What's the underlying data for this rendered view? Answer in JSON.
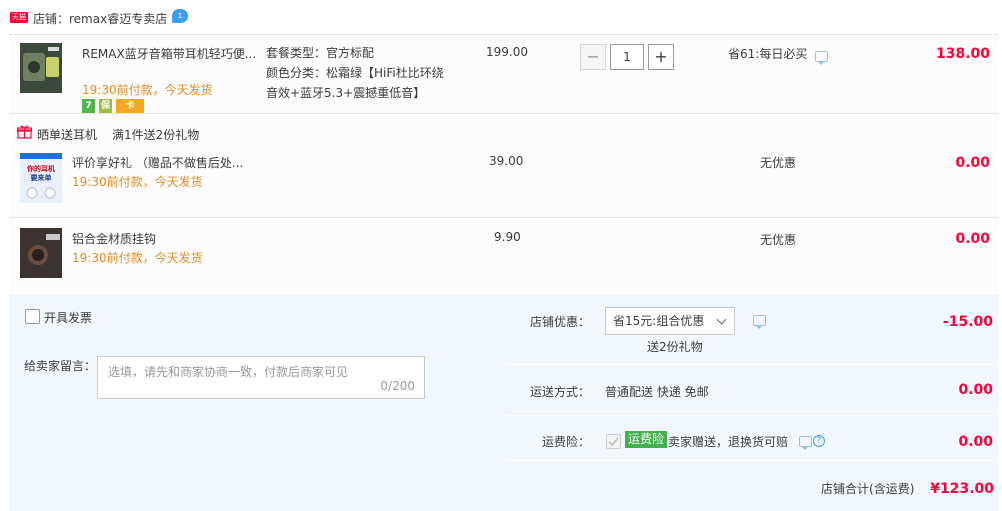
{
  "shop": {
    "badge": "天猫",
    "name": "店铺：remax睿迈专卖店",
    "chat_badge": "1"
  },
  "items": [
    {
      "title": "REMAX蓝牙音箱带耳机轻巧便...",
      "ship_note": "19:30前付款，今天发货",
      "sku_lines": [
        "套餐类型：官方标配",
        "颜色分类：松霜绿【HiFi杜比环绕",
        "音效+蓝牙5.3+震撼重低音】"
      ],
      "price": "199.00",
      "quantity": "1",
      "promo": "省61:每日必买",
      "total": "138.00",
      "feature_icons": [
        "7",
        "保",
        "卡"
      ]
    },
    {
      "title": "评价享好礼 （赠品不做售后处...",
      "ship_note": "19:30前付款，今天发货",
      "price": "39.00",
      "promo": "无优惠",
      "total": "0.00",
      "thumb_text": "你的耳机要来单"
    },
    {
      "title": "铝合金材质挂钩",
      "ship_note": "19:30前付款，今天发货",
      "price": "9.90",
      "promo": "无优惠",
      "total": "0.00"
    }
  ],
  "gift_promo": {
    "label": "晒单送耳机",
    "desc": "满1件送2份礼物"
  },
  "invoice": {
    "label": "开具发票"
  },
  "message": {
    "label": "给卖家留言：",
    "placeholder": "选填，请先和商家协商一致，付款后商家可见",
    "counter": "0/200"
  },
  "store_discount": {
    "label": "店铺优惠：",
    "selected": "省15元:组合优惠",
    "gift_note": "送2份礼物",
    "amount": "-15.00"
  },
  "delivery": {
    "label": "运送方式：",
    "value": "普通配送 快递 免邮",
    "amount": "0.00"
  },
  "insurance": {
    "label": "运费险：",
    "tag": "运费险",
    "desc": "卖家赠送，退换货可赔",
    "amount": "0.00"
  },
  "grand_total": {
    "label": "店铺合计(含运费)",
    "amount": "¥123.00"
  },
  "colors": {
    "accent_red": "#ff0036",
    "ship_orange": "#e38b27",
    "insurance_green": "#3fb14d",
    "panel_blue": "#f2f7ff"
  }
}
